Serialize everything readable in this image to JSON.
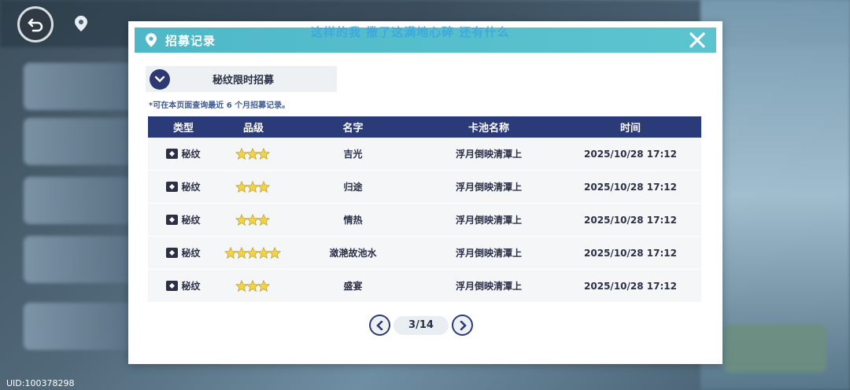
{
  "background": {
    "marquee": "这样的我 撒了这满地心碎 还有什么",
    "uid": "UID:100378298"
  },
  "modal": {
    "title": "招募记录",
    "pool_select": "秘纹限时招募",
    "note": "*可在本页面查询最近 6 个月招募记录。",
    "columns": [
      "类型",
      "品级",
      "名字",
      "卡池名称",
      "时间"
    ],
    "rows": [
      {
        "type": "秘纹",
        "stars": 3,
        "name": "吉光",
        "pool": "浮月倒映清潭上",
        "time": "2025/10/28 17:12"
      },
      {
        "type": "秘纹",
        "stars": 3,
        "name": "归途",
        "pool": "浮月倒映清潭上",
        "time": "2025/10/28 17:12"
      },
      {
        "type": "秘纹",
        "stars": 3,
        "name": "情热",
        "pool": "浮月倒映清潭上",
        "time": "2025/10/28 17:12"
      },
      {
        "type": "秘纹",
        "stars": 5,
        "name": "潋滟故池水",
        "pool": "浮月倒映清潭上",
        "time": "2025/10/28 17:12"
      },
      {
        "type": "秘纹",
        "stars": 3,
        "name": "盛宴",
        "pool": "浮月倒映清潭上",
        "time": "2025/10/28 17:12"
      }
    ],
    "pager": "3/14"
  },
  "icons": {
    "close": "close-icon",
    "pin": "location-pin-icon",
    "chevron": "chevron-down-icon",
    "prev": "chevron-left-icon",
    "next": "chevron-right-icon",
    "star": "star-icon",
    "type": "emblem-icon"
  },
  "colors": {
    "header": "#4fb8c8",
    "table_header": "#2b3a78",
    "star": "#f2d24a",
    "marquee": "#3ca6e0"
  }
}
